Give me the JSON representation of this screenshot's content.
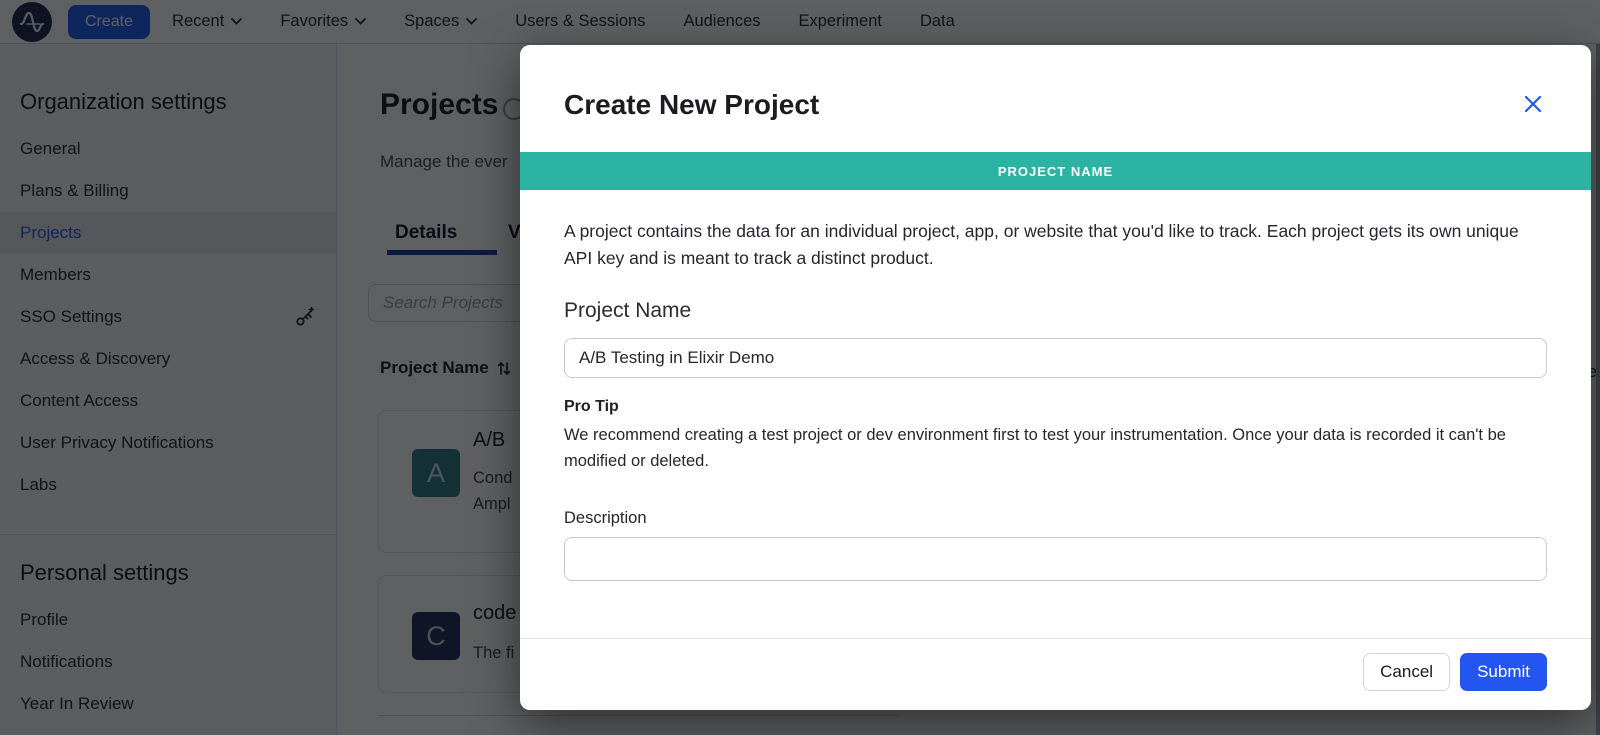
{
  "nav": {
    "create_label": "Create",
    "items": [
      {
        "label": "Recent",
        "chevron": true
      },
      {
        "label": "Favorites",
        "chevron": true
      },
      {
        "label": "Spaces",
        "chevron": true
      },
      {
        "label": "Users & Sessions",
        "chevron": false
      },
      {
        "label": "Audiences",
        "chevron": false
      },
      {
        "label": "Experiment",
        "chevron": false
      },
      {
        "label": "Data",
        "chevron": false
      }
    ]
  },
  "sidebar": {
    "org_heading": "Organization settings",
    "org_items": [
      {
        "label": "General"
      },
      {
        "label": "Plans & Billing"
      },
      {
        "label": "Projects",
        "active": true
      },
      {
        "label": "Members"
      },
      {
        "label": "SSO Settings",
        "icon": "key-icon"
      },
      {
        "label": "Access & Discovery"
      },
      {
        "label": "Content Access"
      },
      {
        "label": "User Privacy Notifications"
      },
      {
        "label": "Labs"
      }
    ],
    "personal_heading": "Personal settings",
    "personal_items": [
      {
        "label": "Profile"
      },
      {
        "label": "Notifications"
      },
      {
        "label": "Year In Review"
      }
    ]
  },
  "content": {
    "title": "Projects",
    "subtitle_fragment": "Manage the ever",
    "tabs": [
      {
        "label": "Details",
        "active": true
      },
      {
        "label": "V",
        "active": false
      }
    ],
    "search_placeholder": "Search Projects",
    "column_header": "Project Name",
    "projects": [
      {
        "initial": "A",
        "avatar_color": "#2e7d88",
        "title_fragment": "A/B",
        "desc_line1": "Cond",
        "desc_line2": "Ampl"
      },
      {
        "initial": "C",
        "avatar_color": "#24335b",
        "title_fragment": "code",
        "desc_line1": "The fi",
        "desc_line2": ""
      }
    ],
    "right_edge_fragment": "e"
  },
  "modal": {
    "title": "Create New Project",
    "banner_label": "PROJECT NAME",
    "intro": "A project contains the data for an individual project, app, or website that you'd like to track. Each project gets its own unique API key and is meant to track a distinct product.",
    "name_heading": "Project Name",
    "name_value": "A/B Testing in Elixir Demo",
    "protip_title": "Pro Tip",
    "protip_text": "We recommend creating a test project or dev environment first to test your instrumentation. Once your data is recorded it can't be modified or deleted.",
    "description_label": "Description",
    "description_value": "",
    "cancel_label": "Cancel",
    "submit_label": "Submit",
    "colors": {
      "banner_teal": "#2bb3a4",
      "submit_blue": "#2356f0",
      "accent_blue": "#1E61F0"
    }
  }
}
